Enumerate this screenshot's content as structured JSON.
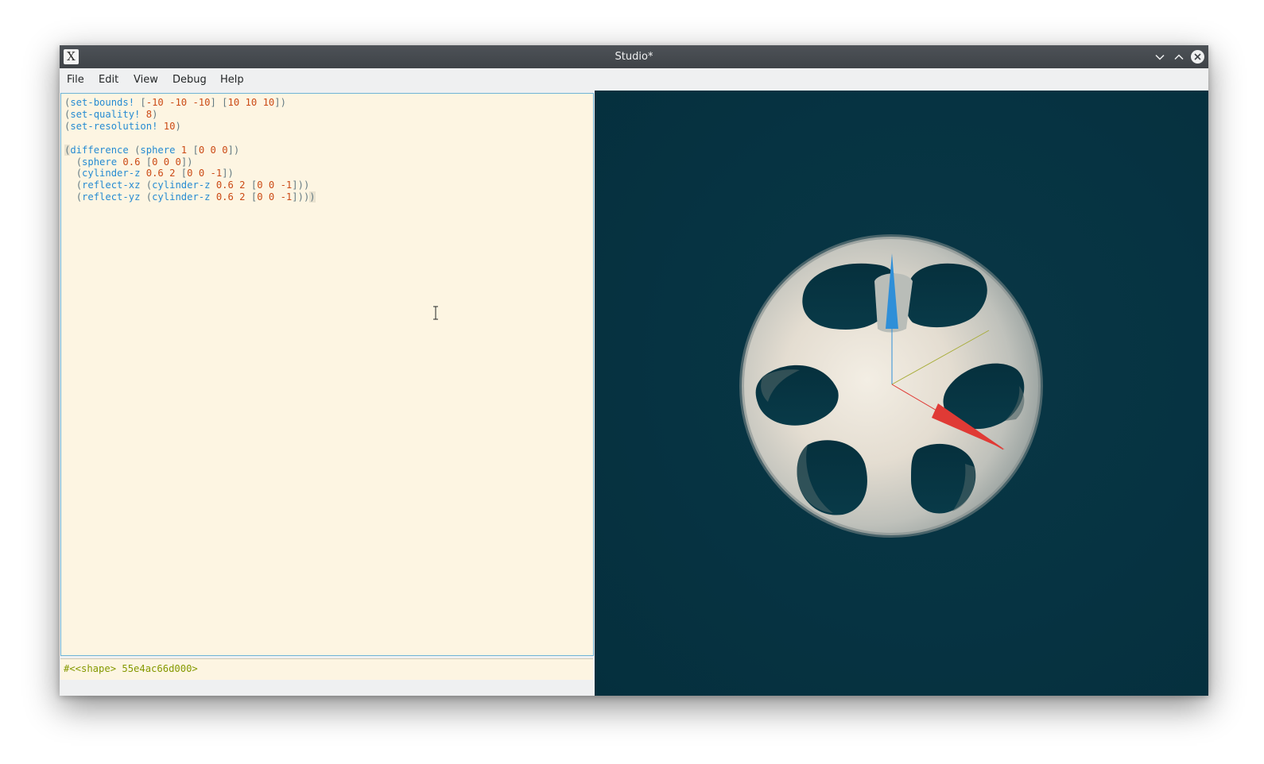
{
  "window": {
    "title": "Studio*",
    "app_icon_glyph": "X",
    "controls": [
      "minimize-icon",
      "maximize-icon",
      "close-icon"
    ]
  },
  "menu": {
    "items": [
      "File",
      "Edit",
      "View",
      "Debug",
      "Help"
    ]
  },
  "editor": {
    "lines": [
      "(set-bounds! [-10 -10 -10] [10 10 10])",
      "(set-quality! 8)",
      "(set-resolution! 10)",
      "",
      "(difference (sphere 1 [0 0 0])",
      "  (sphere 0.6 [0 0 0])",
      "  (cylinder-z 0.6 2 [0 0 -1])",
      "  (reflect-xz (cylinder-z 0.6 2 [0 0 -1]))",
      "  (reflect-yz (cylinder-z 0.6 2 [0 0 -1])))"
    ],
    "colors": {
      "background": "#fdf5e2",
      "function": "#268bd2",
      "number": "#cb4b16",
      "paren": "#657b83"
    }
  },
  "output": {
    "text": "#<<shape> 55e4ac66d000>",
    "color": "#859900"
  },
  "viewport": {
    "background": "#063342",
    "axes": {
      "x_color": "#e03a35",
      "y_color": "#a8ad3a",
      "z_color": "#2f8fd8"
    },
    "shape_color": "#ede6da"
  }
}
